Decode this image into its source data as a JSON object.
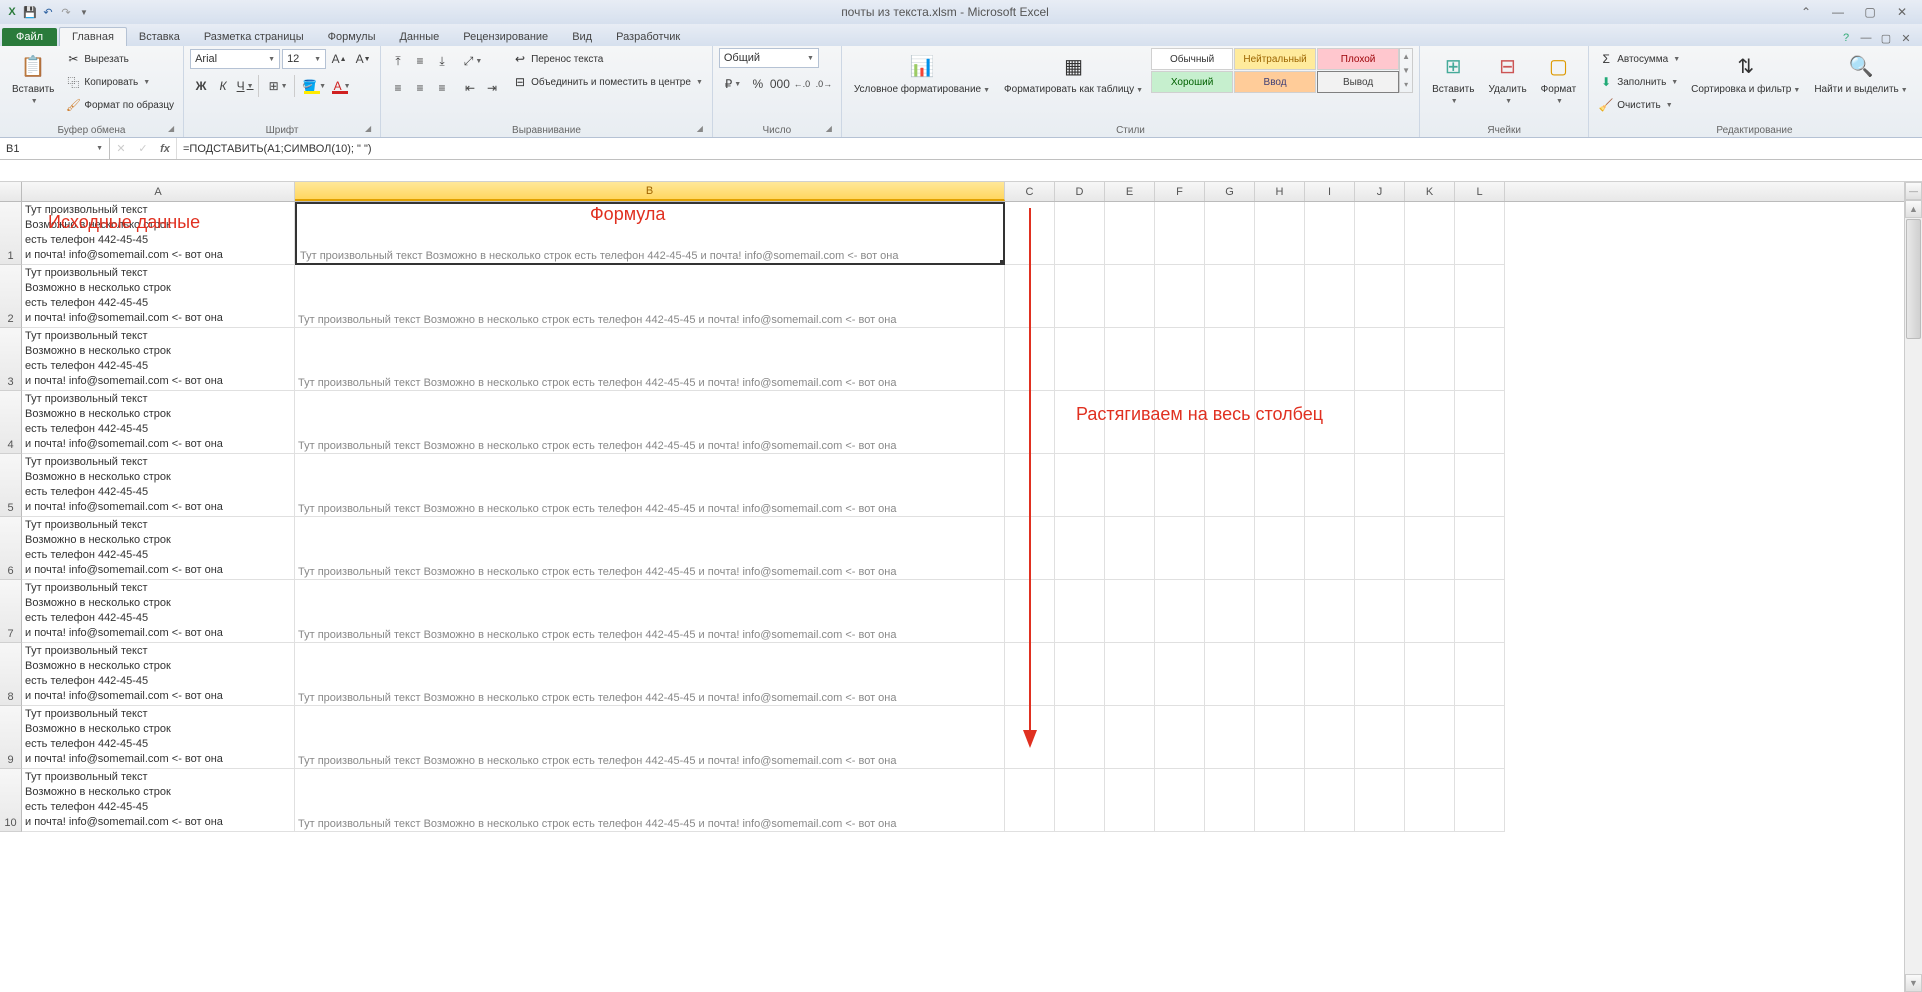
{
  "titlebar": {
    "document_title": "почты из текста.xlsm - Microsoft Excel"
  },
  "tabs": {
    "file": "Файл",
    "items": [
      "Главная",
      "Вставка",
      "Разметка страницы",
      "Формулы",
      "Данные",
      "Рецензирование",
      "Вид",
      "Разработчик"
    ],
    "active_index": 0
  },
  "ribbon": {
    "clipboard": {
      "paste": "Вставить",
      "cut": "Вырезать",
      "copy": "Копировать",
      "format_painter": "Формат по образцу",
      "group": "Буфер обмена"
    },
    "font": {
      "name": "Arial",
      "size": "12",
      "bold": "Ж",
      "italic": "К",
      "underline": "Ч",
      "group": "Шрифт"
    },
    "alignment": {
      "wrap": "Перенос текста",
      "merge": "Объединить и поместить в центре",
      "group": "Выравнивание"
    },
    "number": {
      "format": "Общий",
      "group": "Число"
    },
    "cond_format": {
      "label": "Условное форматирование"
    },
    "format_table": {
      "label": "Форматировать как таблицу"
    },
    "styles_group": "Стили",
    "styles": {
      "normal": "Обычный",
      "neutral": "Нейтральный",
      "bad": "Плохой",
      "good": "Хороший",
      "input": "Ввод",
      "output": "Вывод"
    },
    "cells": {
      "insert": "Вставить",
      "delete": "Удалить",
      "format": "Формат",
      "group": "Ячейки"
    },
    "editing": {
      "autosum": "Автосумма",
      "fill": "Заполнить",
      "clear": "Очистить",
      "sort": "Сортировка и фильтр",
      "find": "Найти и выделить",
      "group": "Редактирование"
    }
  },
  "formula_bar": {
    "cell_ref": "B1",
    "formula": "=ПОДСТАВИТЬ(A1;СИМВОЛ(10); \" \")"
  },
  "columns": {
    "A_width": 273,
    "B_width": 710,
    "narrow": 50,
    "letters": [
      "A",
      "B",
      "C",
      "D",
      "E",
      "F",
      "G",
      "H",
      "I",
      "J",
      "K",
      "L"
    ],
    "selected": "B"
  },
  "grid": {
    "row_height_multi": 63,
    "cell_a_multiline": "Тут произвольный текст\nВозможно в несколько строк\nесть телефон 442-45-45\nи почта! info@somemail.com <- вот она",
    "cell_b_result": "Тут произвольный текст Возможно в несколько строк есть телефон 442-45-45 и почта! info@somemail.com <- вот она",
    "b1_ghost": "Возможно в несколько строк",
    "visible_rows": 10
  },
  "annotations": {
    "source": "Исходные данные",
    "formula": "Формула",
    "stretch": "Растягиваем на весь столбец"
  }
}
